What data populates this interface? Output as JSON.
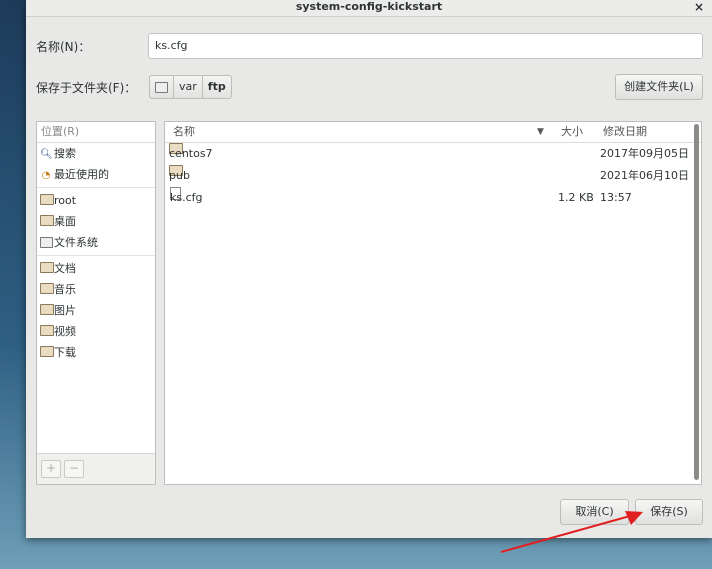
{
  "window": {
    "title": "system-config-kickstart",
    "close_glyph": "×"
  },
  "name_label": "名称(N)：",
  "name_value": "ks.cfg",
  "save_in_label": "保存于文件夹(F)：",
  "path": [
    "var",
    "ftp"
  ],
  "create_folder_button": "创建文件夹(L)",
  "places": {
    "header": "位置(R)",
    "items": [
      {
        "label": "搜索",
        "icon": "search-icon"
      },
      {
        "label": "最近使用的",
        "icon": "recent-icon"
      },
      {
        "label": "root",
        "icon": "home-folder-icon"
      },
      {
        "label": "桌面",
        "icon": "desktop-folder-icon"
      },
      {
        "label": "文件系统",
        "icon": "drive-icon"
      },
      {
        "label": "文档",
        "icon": "documents-folder-icon"
      },
      {
        "label": "音乐",
        "icon": "music-folder-icon"
      },
      {
        "label": "图片",
        "icon": "pictures-folder-icon"
      },
      {
        "label": "视频",
        "icon": "videos-folder-icon"
      },
      {
        "label": "下载",
        "icon": "downloads-folder-icon"
      }
    ],
    "add_glyph": "+",
    "remove_glyph": "−"
  },
  "files": {
    "columns": {
      "name": "名称",
      "size": "大小",
      "modified": "修改日期"
    },
    "rows": [
      {
        "name": "centos7",
        "size": "",
        "modified": "2017年09月05日",
        "type": "folder"
      },
      {
        "name": "pub",
        "size": "",
        "modified": "2021年06月10日",
        "type": "folder"
      },
      {
        "name": "ks.cfg",
        "size": "1.2 KB",
        "modified": "13:57",
        "type": "file"
      }
    ]
  },
  "buttons": {
    "cancel": "取消(C)",
    "save": "保存(S)"
  },
  "colors": {
    "annotation_arrow": "#e02020"
  }
}
